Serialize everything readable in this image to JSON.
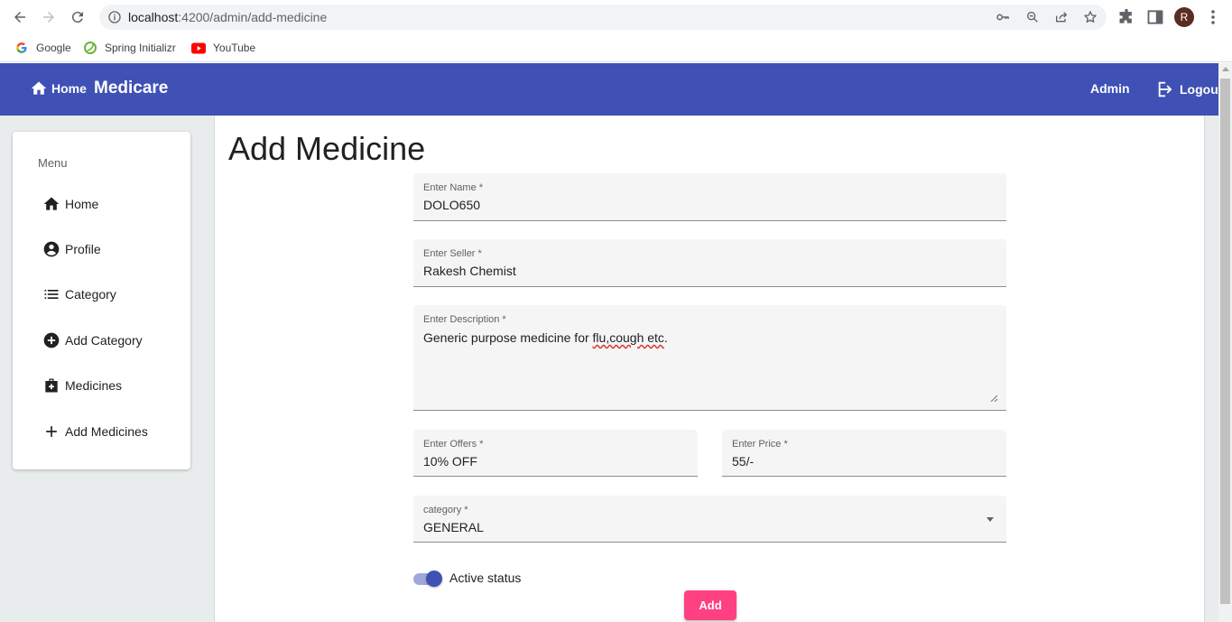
{
  "browser": {
    "url_host": "localhost",
    "url_rest": ":4200/admin/add-medicine",
    "avatar_letter": "R",
    "bookmarks": [
      {
        "label": "Google",
        "icon": "google-icon"
      },
      {
        "label": "Spring Initializr",
        "icon": "spring-icon"
      },
      {
        "label": "YouTube",
        "icon": "youtube-icon"
      }
    ]
  },
  "appbar": {
    "home_label": "Home",
    "title": "Medicare",
    "admin_label": "Admin",
    "logout_label": "Logout",
    "color": "#3f51b5"
  },
  "sidebar": {
    "heading": "Menu",
    "items": [
      {
        "label": "Home",
        "icon": "home-icon"
      },
      {
        "label": "Profile",
        "icon": "account-circle-icon"
      },
      {
        "label": "Category",
        "icon": "list-icon"
      },
      {
        "label": "Add Category",
        "icon": "add-circle-icon"
      },
      {
        "label": "Medicines",
        "icon": "medical-bag-icon"
      },
      {
        "label": "Add Medicines",
        "icon": "plus-icon"
      }
    ]
  },
  "form": {
    "title": "Add Medicine",
    "name": {
      "label": "Enter Name *",
      "value": "DOLO650"
    },
    "seller": {
      "label": "Enter Seller *",
      "value": "Rakesh Chemist"
    },
    "description": {
      "label": "Enter Description *",
      "value_prefix": "Generic purpose medicine for ",
      "value_flagged": "flu,cough etc",
      "value_suffix": "."
    },
    "offers": {
      "label": "Enter Offers *",
      "value": "10% OFF"
    },
    "price": {
      "label": "Enter Price *",
      "value": "55/-"
    },
    "category": {
      "label": "category *",
      "value": "GENERAL"
    },
    "active": {
      "label": "Active status",
      "checked": true
    },
    "submit_label": "Add",
    "accent_color": "#ff4081"
  }
}
